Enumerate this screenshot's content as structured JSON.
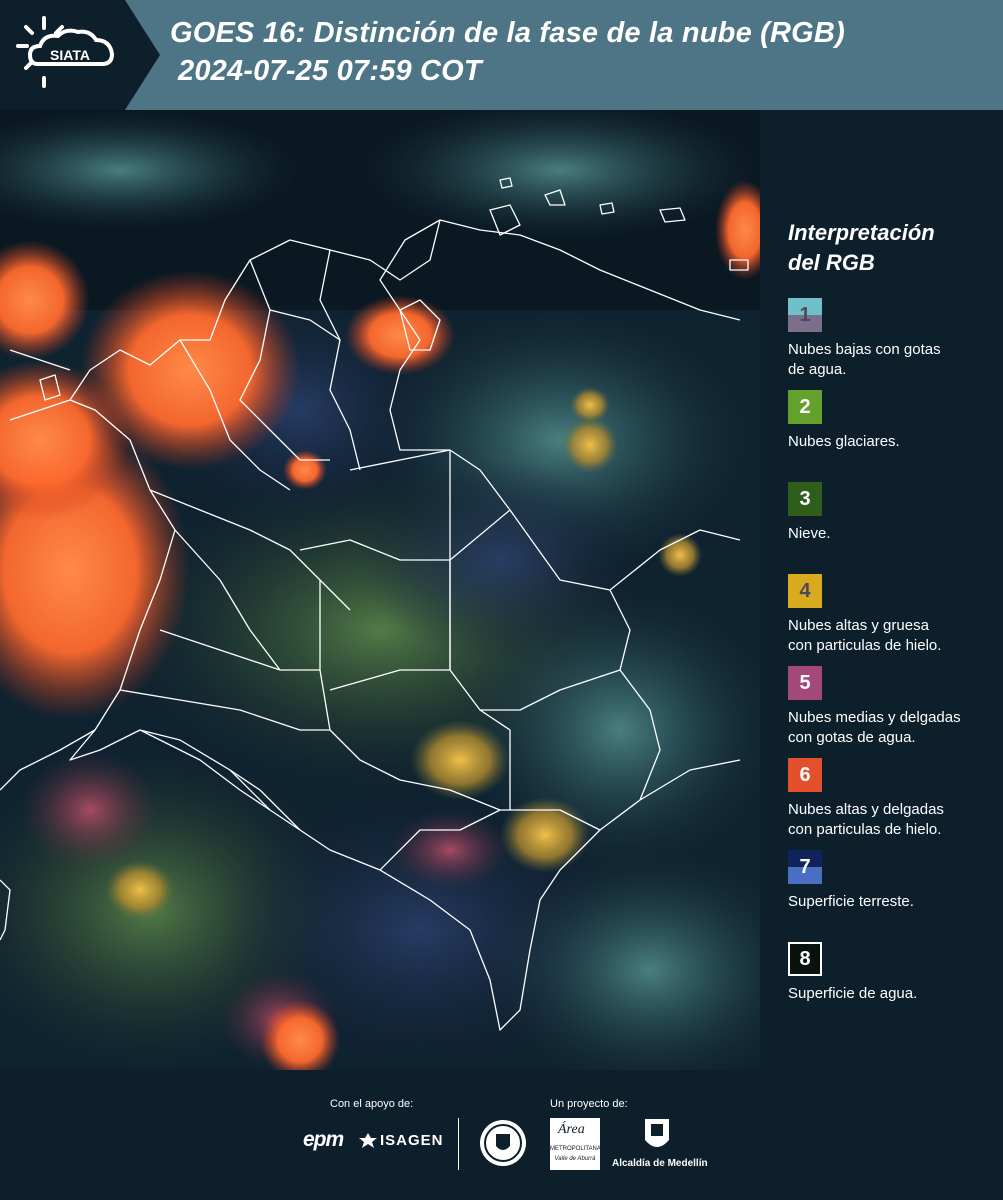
{
  "header": {
    "title_line1": "GOES 16: Distinción de la fase de la nube (RGB)",
    "title_line2": "2024-07-25 07:59 COT",
    "logo_text": "SIATA",
    "logo_icon": "sun-cloud-icon"
  },
  "legend": {
    "title_line1": "Interpretación",
    "title_line2": "del RGB",
    "items": [
      {
        "number": "1",
        "label_line1": "Nubes bajas con gotas",
        "label_line2": "de agua.",
        "colors": [
          "#6fc0c8",
          "#7a6f8c"
        ]
      },
      {
        "number": "2",
        "label_line1": "Nubes glaciares.",
        "label_line2": "",
        "colors": [
          "#63a02c"
        ]
      },
      {
        "number": "3",
        "label_line1": "Nieve.",
        "label_line2": "",
        "colors": [
          "#2e5e1a"
        ]
      },
      {
        "number": "4",
        "label_line1": "Nubes altas y gruesa",
        "label_line2": "con particulas de hielo.",
        "colors": [
          "#d9a91e"
        ]
      },
      {
        "number": "5",
        "label_line1": "Nubes medias y delgadas",
        "label_line2": "con gotas de agua.",
        "colors": [
          "#a4487c"
        ]
      },
      {
        "number": "6",
        "label_line1": "Nubes altas y delgadas",
        "label_line2": "con particulas de hielo.",
        "colors": [
          "#e5502c"
        ]
      },
      {
        "number": "7",
        "label_line1": "Superficie terreste.",
        "label_line2": "",
        "colors": [
          "#10235a",
          "#4a6fc2"
        ]
      },
      {
        "number": "8",
        "label_line1": "Superficie de agua.",
        "label_line2": "",
        "colors": [
          "#0a120e"
        ]
      }
    ]
  },
  "footer": {
    "support_label": "Con el apoyo de:",
    "project_label": "Un proyecto de:",
    "sponsor1": "epm",
    "sponsor2": "ISAGEN",
    "partner1_icon": "medellin-seal-icon",
    "partner2_line1": "Área",
    "partner2_line2": "METROPOLITANA",
    "partner2_line3": "Valle de Aburrá",
    "partner3": "Alcaldía de Medellín"
  },
  "colors": {
    "header_bg": "#4d7585",
    "panel_bg": "#0c1f2b",
    "cloud_orange": "#ff7a3a",
    "cloud_yellow": "#e8b030",
    "border_line": "#ffffff"
  }
}
